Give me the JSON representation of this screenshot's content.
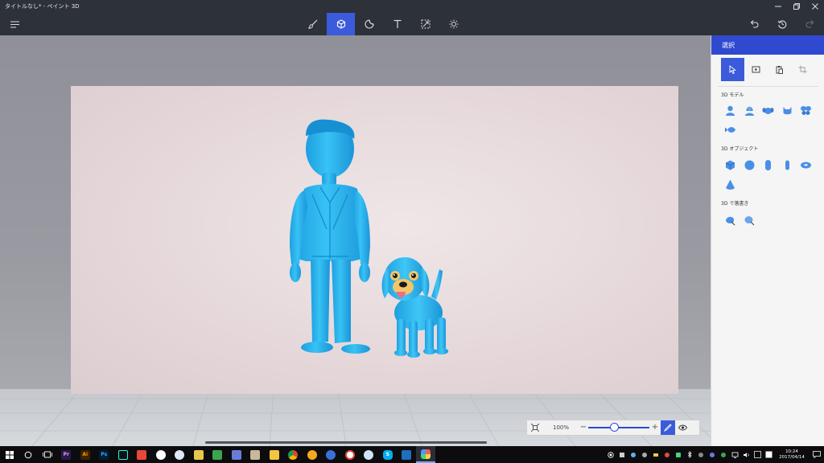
{
  "window": {
    "title": "タイトルなし* - ペイント 3D",
    "controls": [
      "minimize",
      "restore",
      "close"
    ]
  },
  "toolbar": {
    "menu_icon": "hamburger-icon",
    "tools": [
      {
        "id": "art-tools",
        "icon": "brush-icon",
        "active": false
      },
      {
        "id": "3d-objects",
        "icon": "cube-icon",
        "active": true
      },
      {
        "id": "stickers",
        "icon": "sticker-icon",
        "active": false
      },
      {
        "id": "text",
        "icon": "text-icon",
        "active": false
      },
      {
        "id": "canvas",
        "icon": "resize-icon",
        "active": false
      },
      {
        "id": "effects",
        "icon": "sun-icon",
        "active": false
      }
    ],
    "history": [
      {
        "id": "undo",
        "icon": "undo-icon",
        "enabled": true
      },
      {
        "id": "history",
        "icon": "history-icon",
        "enabled": true
      },
      {
        "id": "redo",
        "icon": "redo-icon",
        "enabled": false
      }
    ]
  },
  "panel": {
    "header": "選択",
    "selection_tools": [
      "pointer-icon",
      "region-select-icon",
      "paste-icon",
      "crop-icon"
    ],
    "sections": [
      {
        "label": "3D モデル",
        "items": [
          "man-model-icon",
          "woman-model-icon",
          "dog-model-icon",
          "cat-model-icon",
          "butterfly-model-icon",
          "fish-model-icon"
        ]
      },
      {
        "label": "3D オブジェクト",
        "items": [
          "cube-object-icon",
          "sphere-object-icon",
          "capsule-object-icon",
          "cylinder-object-icon",
          "donut-object-icon",
          "cone-object-icon"
        ]
      },
      {
        "label": "3D で落書き",
        "items": [
          "sharp-edge-doodle-icon",
          "soft-edge-doodle-icon"
        ]
      }
    ]
  },
  "zoom": {
    "percent_label": "100%",
    "minus": "−",
    "plus": "+",
    "level": 0.41
  },
  "taskbar": {
    "apps": [
      "start-icon",
      "search-icon",
      "task-view-icon",
      "premiere-icon",
      "illustrator-icon",
      "photoshop-icon",
      "tiktok-icon",
      "app-red-icon",
      "soccer-icon",
      "app-dial-icon",
      "app-monitor-icon",
      "app-tree-icon",
      "app-pen-icon",
      "app-photo-icon",
      "file-explorer-icon",
      "chrome-icon",
      "app-orange-icon",
      "app-cloud-icon",
      "app-ball-icon",
      "app-blue-icon",
      "skype-icon",
      "vscode-icon",
      "paint3d-icon"
    ],
    "running_app": "paint3d-icon",
    "time": "10:24",
    "date": "2017/04/14"
  },
  "colors": {
    "accent": "#3b5bdb",
    "model_blue": "#2bb5f0",
    "titlebar": "#2d3139"
  }
}
